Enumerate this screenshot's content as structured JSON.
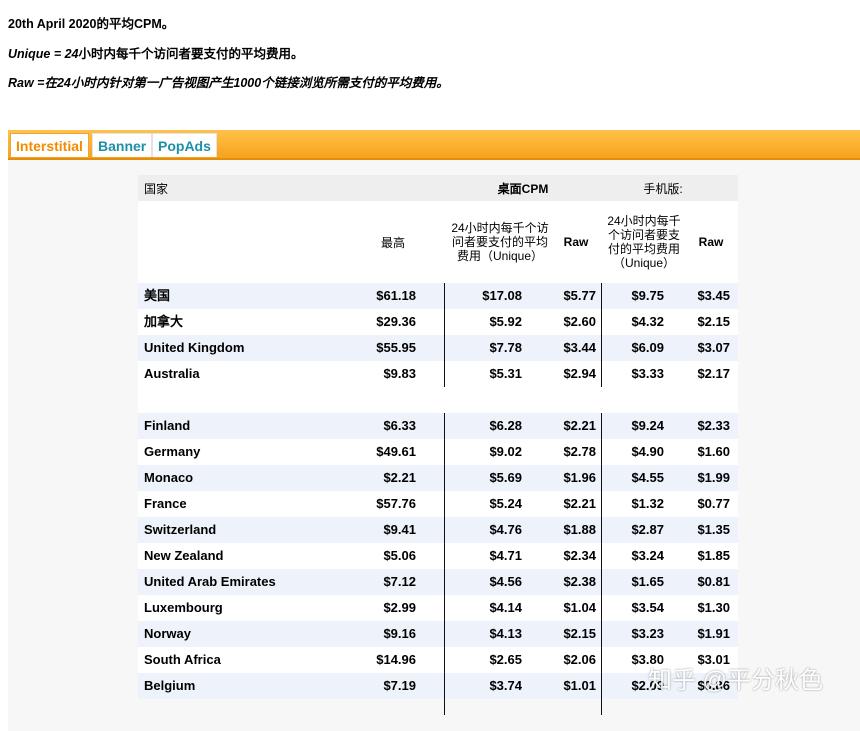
{
  "intro": {
    "line1": "20th April 2020的平均CPM。",
    "line2_prefix": "Unique = 24",
    "line2_rest": "小时内每千个访问者要支付的平均费用。",
    "line3_prefix": "Raw =",
    "line3_rest": "在24小时内针对第一广告视图产生1000个链接浏览所需支付的平均费用。"
  },
  "tabs": [
    "Interstitial",
    "Banner",
    "PopAds"
  ],
  "table": {
    "country_header": "国家",
    "desktop_header": "桌面CPM",
    "mobile_header": "手机版:",
    "max_header": "最高",
    "desktop_unique_header": "24小时内每千个访问者要支付的平均费用（Unique）",
    "desktop_raw_header": "Raw",
    "mobile_unique_header": "24小时内每千个访问者要支付的平均费用（Unique）",
    "mobile_raw_header": "Raw",
    "group1": [
      [
        "美国",
        "$61.18",
        "$17.08",
        "$5.77",
        "$9.75",
        "$3.45"
      ],
      [
        "加拿大",
        "$29.36",
        "$5.92",
        "$2.60",
        "$4.32",
        "$2.15"
      ],
      [
        "United Kingdom",
        "$55.95",
        "$7.78",
        "$3.44",
        "$6.09",
        "$3.07"
      ],
      [
        "Australia",
        "$9.83",
        "$5.31",
        "$2.94",
        "$3.33",
        "$2.17"
      ]
    ],
    "group2": [
      [
        "Finland",
        "$6.33",
        "$6.28",
        "$2.21",
        "$9.24",
        "$2.33"
      ],
      [
        "Germany",
        "$49.61",
        "$9.02",
        "$2.78",
        "$4.90",
        "$1.60"
      ],
      [
        "Monaco",
        "$2.21",
        "$5.69",
        "$1.96",
        "$4.55",
        "$1.99"
      ],
      [
        "France",
        "$57.76",
        "$5.24",
        "$2.21",
        "$1.32",
        "$0.77"
      ],
      [
        "Switzerland",
        "$9.41",
        "$4.76",
        "$1.88",
        "$2.87",
        "$1.35"
      ],
      [
        "New Zealand",
        "$5.06",
        "$4.71",
        "$2.34",
        "$3.24",
        "$1.85"
      ],
      [
        "United Arab Emirates",
        "$7.12",
        "$4.56",
        "$2.38",
        "$1.65",
        "$0.81"
      ],
      [
        "Luxembourg",
        "$2.99",
        "$4.14",
        "$1.04",
        "$3.54",
        "$1.30"
      ],
      [
        "Norway",
        "$9.16",
        "$4.13",
        "$2.15",
        "$3.23",
        "$1.91"
      ],
      [
        "South Africa",
        "$14.96",
        "$2.65",
        "$2.06",
        "$3.80",
        "$3.01"
      ],
      [
        "Belgium",
        "$7.19",
        "$3.74",
        "$1.01",
        "$2.09",
        "$0.86"
      ]
    ]
  },
  "watermark": "知乎 @平分秋色"
}
